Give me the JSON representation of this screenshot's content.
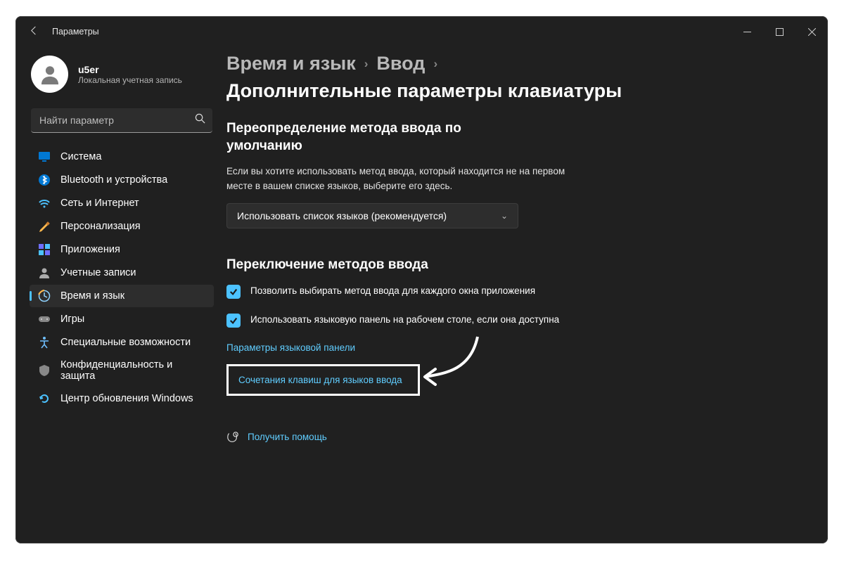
{
  "titlebar": {
    "title": "Параметры"
  },
  "user": {
    "name": "u5er",
    "subtitle": "Локальная учетная запись"
  },
  "search": {
    "placeholder": "Найти параметр"
  },
  "sidebar": {
    "items": [
      {
        "label": "Система",
        "icon": "system"
      },
      {
        "label": "Bluetooth и устройства",
        "icon": "bluetooth"
      },
      {
        "label": "Сеть и Интернет",
        "icon": "network"
      },
      {
        "label": "Персонализация",
        "icon": "personalization"
      },
      {
        "label": "Приложения",
        "icon": "apps"
      },
      {
        "label": "Учетные записи",
        "icon": "accounts"
      },
      {
        "label": "Время и язык",
        "icon": "time",
        "active": true
      },
      {
        "label": "Игры",
        "icon": "gaming"
      },
      {
        "label": "Специальные возможности",
        "icon": "accessibility"
      },
      {
        "label": "Конфиденциальность и защита",
        "icon": "privacy"
      },
      {
        "label": "Центр обновления Windows",
        "icon": "update"
      }
    ]
  },
  "breadcrumbs": {
    "parent1": "Время и язык",
    "parent2": "Ввод",
    "current": "Дополнительные параметры клавиатуры"
  },
  "main": {
    "section1_heading": "Переопределение метода ввода по умолчанию",
    "section1_desc": "Если вы хотите использовать метод ввода, который находится не на первом месте в вашем списке языков, выберите его здесь.",
    "dropdown_value": "Использовать список языков (рекомендуется)",
    "section2_heading": "Переключение методов ввода",
    "check1": "Позволить выбирать метод ввода для каждого окна приложения",
    "check2": "Использовать языковую панель на рабочем столе, если она доступна",
    "link1": "Параметры языковой панели",
    "link2": "Сочетания клавиш для языков ввода",
    "help": "Получить помощь"
  }
}
